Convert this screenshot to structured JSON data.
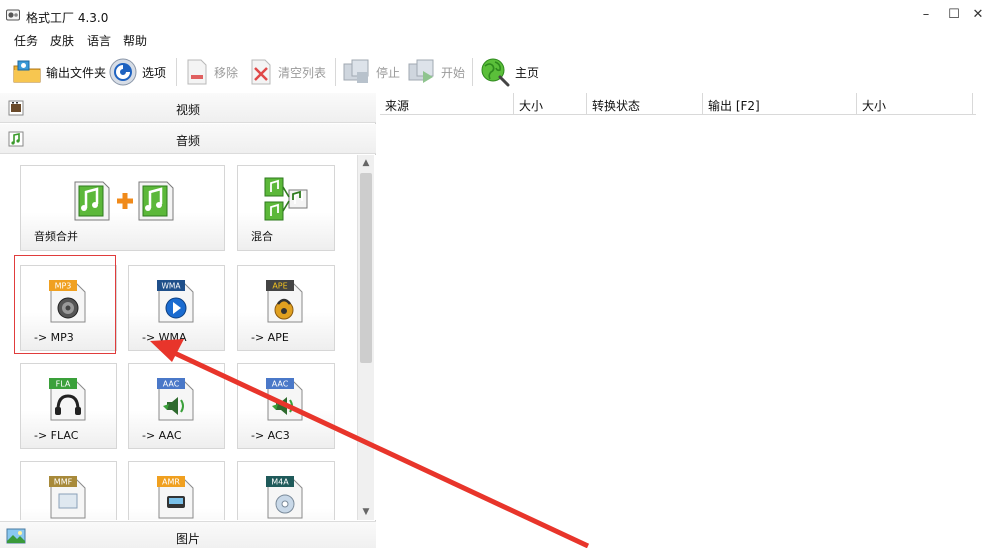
{
  "window": {
    "title": "格式工厂 4.3.0",
    "minimize_glyph": "–",
    "maximize_glyph": "☐",
    "close_glyph": "✕"
  },
  "menu": {
    "items": [
      "任务",
      "皮肤",
      "语言",
      "帮助"
    ]
  },
  "toolbar": {
    "output_folder": "输出文件夹",
    "options": "选项",
    "remove": "移除",
    "clear_list": "清空列表",
    "stop": "停止",
    "start": "开始",
    "home": "主页"
  },
  "categories": {
    "video": "视频",
    "audio": "音频",
    "image": "图片"
  },
  "tiles": [
    {
      "label": "音频合并",
      "icon": "audio-merge-icon",
      "badge": ""
    },
    {
      "label": "混合",
      "icon": "audio-mix-icon",
      "badge": ""
    },
    {
      "label": "-> MP3",
      "icon": "mp3-icon",
      "badge": "MP3"
    },
    {
      "label": "-> WMA",
      "icon": "wma-icon",
      "badge": "WMA"
    },
    {
      "label": "-> APE",
      "icon": "ape-icon",
      "badge": "APE"
    },
    {
      "label": "-> FLAC",
      "icon": "flac-icon",
      "badge": "FLA"
    },
    {
      "label": "-> AAC",
      "icon": "aac-icon",
      "badge": "AAC"
    },
    {
      "label": "-> AC3",
      "icon": "ac3-icon",
      "badge": "AAC"
    },
    {
      "label": "",
      "icon": "mmf-icon",
      "badge": "MMF"
    },
    {
      "label": "",
      "icon": "amr-icon",
      "badge": "AMR"
    },
    {
      "label": "",
      "icon": "m4a-icon",
      "badge": "M4A"
    }
  ],
  "table": {
    "columns": [
      "来源",
      "大小",
      "转换状态",
      "输出 [F2]",
      "大小"
    ]
  },
  "colors": {
    "annotation_red": "#e8352b",
    "badge_orange": "#f0a020",
    "badge_blue": "#4a78c8",
    "badge_green": "#3aa03a"
  }
}
